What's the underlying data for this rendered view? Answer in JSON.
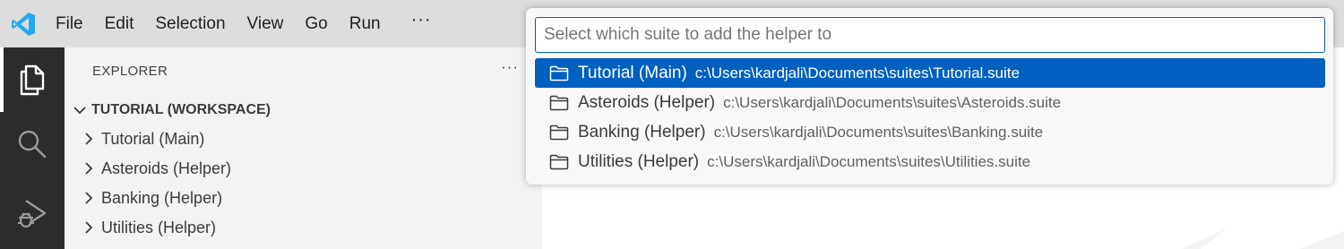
{
  "menu": {
    "items": [
      "File",
      "Edit",
      "Selection",
      "View",
      "Go",
      "Run"
    ],
    "more": "···"
  },
  "activity_bar": {
    "items": [
      {
        "icon": "files-icon",
        "active": true
      },
      {
        "icon": "search-icon",
        "active": false
      },
      {
        "icon": "run-debug-icon",
        "active": false
      }
    ]
  },
  "sidebar": {
    "title": "EXPLORER",
    "more": "···",
    "workspace": "TUTORIAL (WORKSPACE)",
    "folders": [
      "Tutorial (Main)",
      "Asteroids (Helper)",
      "Banking (Helper)",
      "Utilities (Helper)"
    ]
  },
  "quick_pick": {
    "placeholder": "Select which suite to add the helper to",
    "items": [
      {
        "label": "Tutorial (Main)",
        "description": "c:\\Users\\kardjali\\Documents\\suites\\Tutorial.suite",
        "selected": true
      },
      {
        "label": "Asteroids (Helper)",
        "description": "c:\\Users\\kardjali\\Documents\\suites\\Asteroids.suite",
        "selected": false
      },
      {
        "label": "Banking (Helper)",
        "description": "c:\\Users\\kardjali\\Documents\\suites\\Banking.suite",
        "selected": false
      },
      {
        "label": "Utilities (Helper)",
        "description": "c:\\Users\\kardjali\\Documents\\suites\\Utilities.suite",
        "selected": false
      }
    ]
  },
  "colors": {
    "accent": "#0060c0",
    "logo": "#23a9f2",
    "activity_bar": "#2c2c2c",
    "sidebar": "#f3f3f3",
    "titlebar": "#dddddd"
  }
}
